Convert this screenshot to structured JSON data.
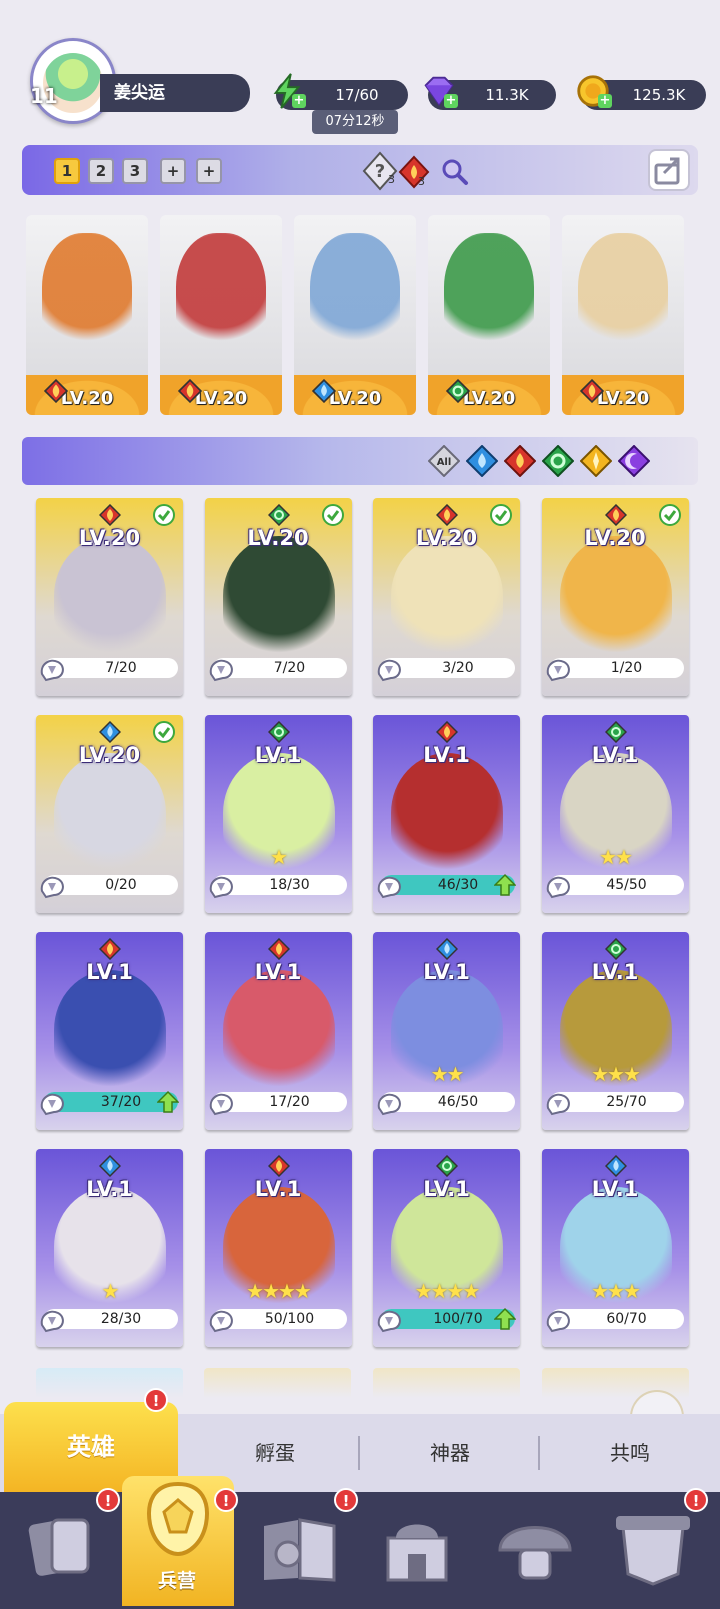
{
  "player": {
    "level": "11",
    "name": "姜尖运"
  },
  "resources": {
    "energy": "17/60",
    "energy_timer": "07分12秒",
    "gems": "11.3K",
    "gold": "125.3K"
  },
  "team": {
    "slot_tabs": [
      "1",
      "2",
      "3",
      "+",
      "+"
    ],
    "active_slot": "1",
    "counts": {
      "help": "3",
      "fire": "3"
    },
    "members": [
      {
        "level": "LV.20",
        "element": "fire",
        "color": "#e07a2e"
      },
      {
        "level": "LV.20",
        "element": "fire",
        "color": "#c23a3a"
      },
      {
        "level": "LV.20",
        "element": "water",
        "color": "#7fa7d6"
      },
      {
        "level": "LV.20",
        "element": "wind",
        "color": "#3d9a4a"
      },
      {
        "level": "LV.20",
        "element": "fire",
        "color": "#e8cfa0"
      }
    ]
  },
  "filters": {
    "all_label": "All",
    "elements": [
      "water",
      "fire",
      "wind",
      "light",
      "dark"
    ]
  },
  "heroes": [
    {
      "level": "LV.20",
      "element": "fire",
      "progress": "7/20",
      "fill": 0.35,
      "bg": "gold",
      "owned": true,
      "art": "#c9c3d3",
      "stars": 0,
      "upgrade": false
    },
    {
      "level": "LV.20",
      "element": "wind",
      "progress": "7/20",
      "fill": 0.35,
      "bg": "gold",
      "owned": true,
      "art": "#2f4a34",
      "stars": 0,
      "upgrade": false
    },
    {
      "level": "LV.20",
      "element": "fire",
      "progress": "3/20",
      "fill": 0.15,
      "bg": "gold",
      "owned": true,
      "art": "#efe2b8",
      "stars": 0,
      "upgrade": false
    },
    {
      "level": "LV.20",
      "element": "fire",
      "progress": "1/20",
      "fill": 0.05,
      "bg": "gold",
      "owned": true,
      "art": "#f0b54a",
      "stars": 0,
      "upgrade": false
    },
    {
      "level": "LV.20",
      "element": "water",
      "progress": "0/20",
      "fill": 0.0,
      "bg": "gold",
      "owned": true,
      "art": "#d7d7e2",
      "stars": 0,
      "upgrade": false
    },
    {
      "level": "LV.1",
      "element": "wind",
      "progress": "18/30",
      "fill": 0.6,
      "bg": "purple",
      "owned": false,
      "art": "#d9efa2",
      "stars": 1,
      "upgrade": false
    },
    {
      "level": "LV.1",
      "element": "fire",
      "progress": "46/30",
      "fill": 1.0,
      "bg": "purple",
      "owned": false,
      "art": "#b52f2f",
      "stars": 0,
      "upgrade": true
    },
    {
      "level": "LV.1",
      "element": "wind",
      "progress": "45/50",
      "fill": 0.9,
      "bg": "purple",
      "owned": false,
      "art": "#d9d5c4",
      "stars": 2,
      "upgrade": false
    },
    {
      "level": "LV.1",
      "element": "fire",
      "progress": "37/20",
      "fill": 1.0,
      "bg": "purple",
      "owned": false,
      "art": "#3a4fb0",
      "stars": 0,
      "upgrade": true
    },
    {
      "level": "LV.1",
      "element": "fire",
      "progress": "17/20",
      "fill": 0.85,
      "bg": "purple",
      "owned": false,
      "art": "#d85a6a",
      "stars": 0,
      "upgrade": false
    },
    {
      "level": "LV.1",
      "element": "water",
      "progress": "46/50",
      "fill": 0.92,
      "bg": "purple",
      "owned": false,
      "art": "#7d8ee0",
      "stars": 2,
      "upgrade": false
    },
    {
      "level": "LV.1",
      "element": "wind",
      "progress": "25/70",
      "fill": 0.36,
      "bg": "purple",
      "owned": false,
      "art": "#b79a3c",
      "stars": 3,
      "upgrade": false
    },
    {
      "level": "LV.1",
      "element": "water",
      "progress": "28/30",
      "fill": 0.93,
      "bg": "purple",
      "owned": false,
      "art": "#e7e2ea",
      "stars": 1,
      "upgrade": false
    },
    {
      "level": "LV.1",
      "element": "fire",
      "progress": "50/100",
      "fill": 0.5,
      "bg": "purple",
      "owned": false,
      "art": "#d8653c",
      "stars": 4,
      "upgrade": false
    },
    {
      "level": "LV.1",
      "element": "wind",
      "progress": "100/70",
      "fill": 1.0,
      "bg": "purple",
      "owned": false,
      "art": "#cfe69a",
      "stars": 4,
      "upgrade": true
    },
    {
      "level": "LV.1",
      "element": "water",
      "progress": "60/70",
      "fill": 0.86,
      "bg": "purple",
      "owned": false,
      "art": "#9fd3ea",
      "stars": 3,
      "upgrade": false
    }
  ],
  "sub_tabs": [
    "英雄",
    "孵蛋",
    "神器",
    "共鸣"
  ],
  "nav": {
    "active_label": "兵营"
  },
  "colors": {
    "fire": "#d7352b",
    "water": "#2f8fe0",
    "wind": "#2aa44a",
    "light": "#f3b520",
    "dark": "#8a3fe0",
    "accent": "#f4b524",
    "nav_bg": "#3b3c5a"
  }
}
